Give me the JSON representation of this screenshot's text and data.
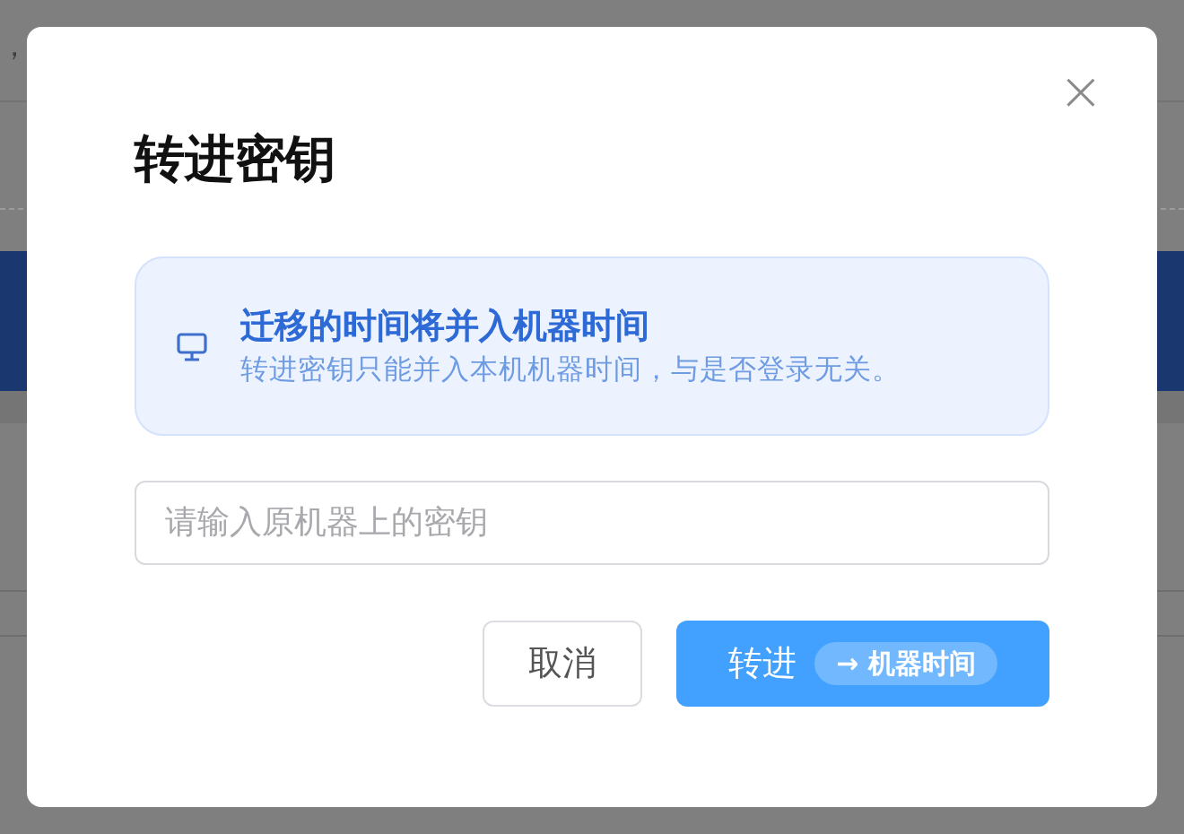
{
  "background": {
    "text": "，"
  },
  "dialog": {
    "title": "转进密钥",
    "close": "×",
    "notice": {
      "title": "迁移的时间将并入机器时间",
      "text": "转进密钥只能并入本机机器时间，与是否登录无关。"
    },
    "key_field": {
      "placeholder": "请输入原机器上的密钥"
    },
    "buttons": [
      {
        "kind": "secondary",
        "label": "取消"
      },
      {
        "kind": "primary",
        "label": "转进",
        "tag": "→ 机器时间"
      }
    ]
  }
}
